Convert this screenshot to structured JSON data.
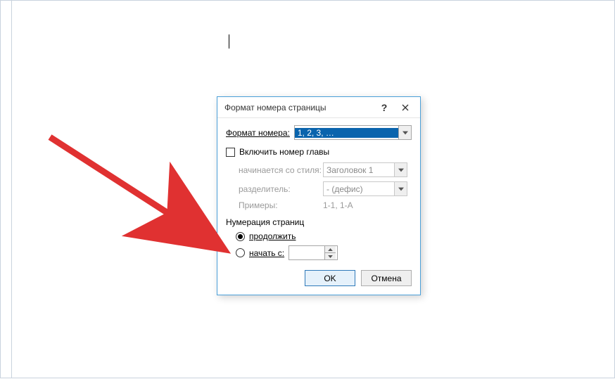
{
  "dialog": {
    "title": "Формат номера страницы",
    "format_label_pre": "Формат номера:",
    "format_value": "1, 2, 3, …",
    "include_chapter": "Включить номер главы",
    "starts_with_style_label": "начинается со стиля:",
    "starts_with_style_value": "Заголовок 1",
    "separator_label": "разделитель:",
    "separator_value": "-   (дефис)",
    "examples_label": "Примеры:",
    "examples_value": "1-1, 1-A",
    "numbering_group": "Нумерация страниц",
    "continue_label": "продолжить",
    "start_at_label": "начать с:",
    "start_at_value": "",
    "ok": "OK",
    "cancel": "Отмена"
  }
}
